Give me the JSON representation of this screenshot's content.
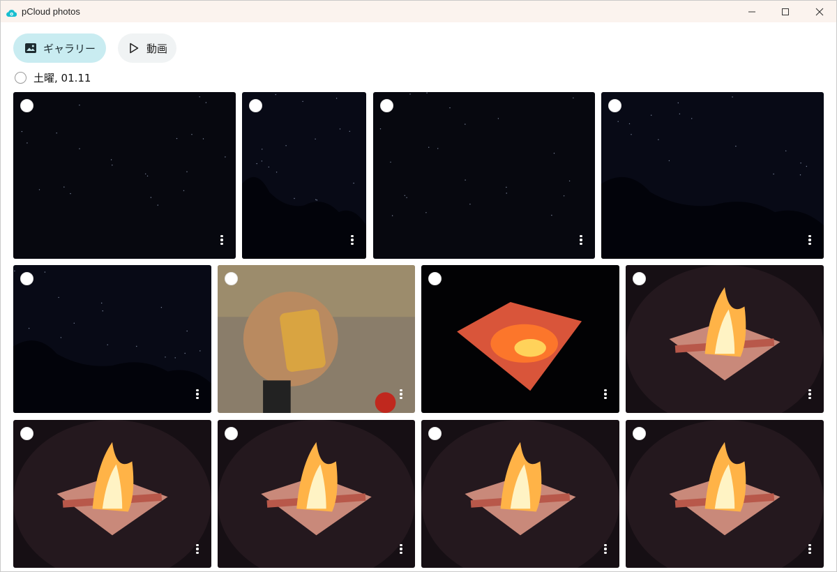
{
  "window": {
    "title": "pCloud photos"
  },
  "tabs": [
    {
      "label": "ギャラリー",
      "icon": "image-icon",
      "active": true
    },
    {
      "label": "動画",
      "icon": "play-icon",
      "active": false
    }
  ],
  "date_group": {
    "label": "土曜, 01.11"
  },
  "photos": [
    {
      "scene": "night-sky"
    },
    {
      "scene": "night-sky-silhouette"
    },
    {
      "scene": "night-sky"
    },
    {
      "scene": "night-sky-silhouette"
    },
    {
      "scene": "night-sky-silhouette"
    },
    {
      "scene": "toast-plate"
    },
    {
      "scene": "fire-pit-embers"
    },
    {
      "scene": "campfire"
    },
    {
      "scene": "campfire"
    },
    {
      "scene": "campfire"
    },
    {
      "scene": "campfire"
    },
    {
      "scene": "campfire"
    }
  ],
  "colors": {
    "active_tab": "#c9ecf1",
    "inactive_tab": "#f0f3f4",
    "titlebar": "#fbf3ee",
    "brand": "#17bed0"
  }
}
